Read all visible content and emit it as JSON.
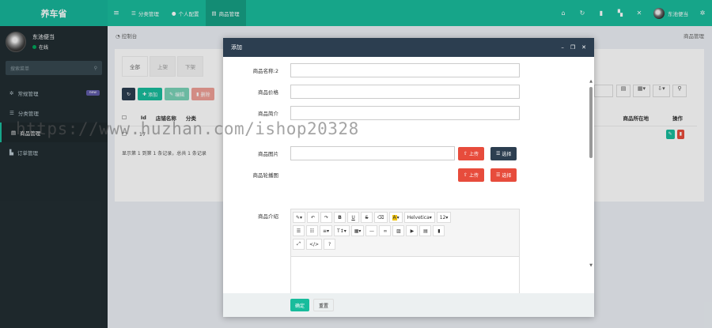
{
  "brand": "养车省",
  "topnav": {
    "toggle_icon": "menu-icon",
    "items": [
      {
        "label": "分类管理",
        "icon": "list-icon",
        "active": false
      },
      {
        "label": "个人配置",
        "icon": "user-icon",
        "active": false
      },
      {
        "label": "商品管理",
        "icon": "database-icon",
        "active": true
      }
    ],
    "right_icons": [
      "home-icon",
      "refresh-icon",
      "trash-icon",
      "translate-icon",
      "fullscreen-icon"
    ],
    "user_name": "东池便当",
    "settings_icon": "cogs-icon"
  },
  "sidebar": {
    "user_name": "东池便当",
    "status": "在线",
    "search_placeholder": "搜索菜单",
    "items": [
      {
        "label": "常规管理",
        "icon": "cogs-icon",
        "badge": "new"
      },
      {
        "label": "分类管理",
        "icon": "list-icon"
      },
      {
        "label": "商品管理",
        "icon": "database-icon",
        "active": true
      },
      {
        "label": "订单管理",
        "icon": "order-icon"
      }
    ]
  },
  "breadcrumb": {
    "left": "控制台",
    "right": "商品管理"
  },
  "tabs": [
    "全部",
    "上架",
    "下架"
  ],
  "toolbar": {
    "add": "添加",
    "edit": "编辑",
    "delete": "删除"
  },
  "table": {
    "headers": [
      "Id",
      "店铺名称",
      "分类"
    ],
    "right_headers": [
      "商品所在地",
      "操作"
    ],
    "row_id": "17",
    "pager": "显示第 1 到第 1 条记录，总共 1 条记录"
  },
  "modal": {
    "title": "添加",
    "fields": {
      "name": "商品名称:2",
      "price": "商品价格",
      "intro": "商品简介",
      "images": "商品图片",
      "detail_images": "商品轮播图",
      "desc": "商品介绍"
    },
    "upload": "上传",
    "choose": "选择",
    "editor": {
      "font": "Helvetica",
      "size": "12",
      "help": "?"
    },
    "submit": "确定",
    "reset": "重置"
  },
  "watermark": "https://www.huzhan.com/ishop20328"
}
